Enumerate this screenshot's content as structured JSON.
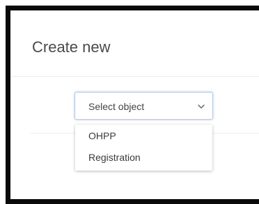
{
  "dialog": {
    "title": "Create new"
  },
  "select": {
    "placeholder": "Select object",
    "icon": "chevron-down-icon",
    "options": [
      "OHPP",
      "Registration"
    ]
  }
}
